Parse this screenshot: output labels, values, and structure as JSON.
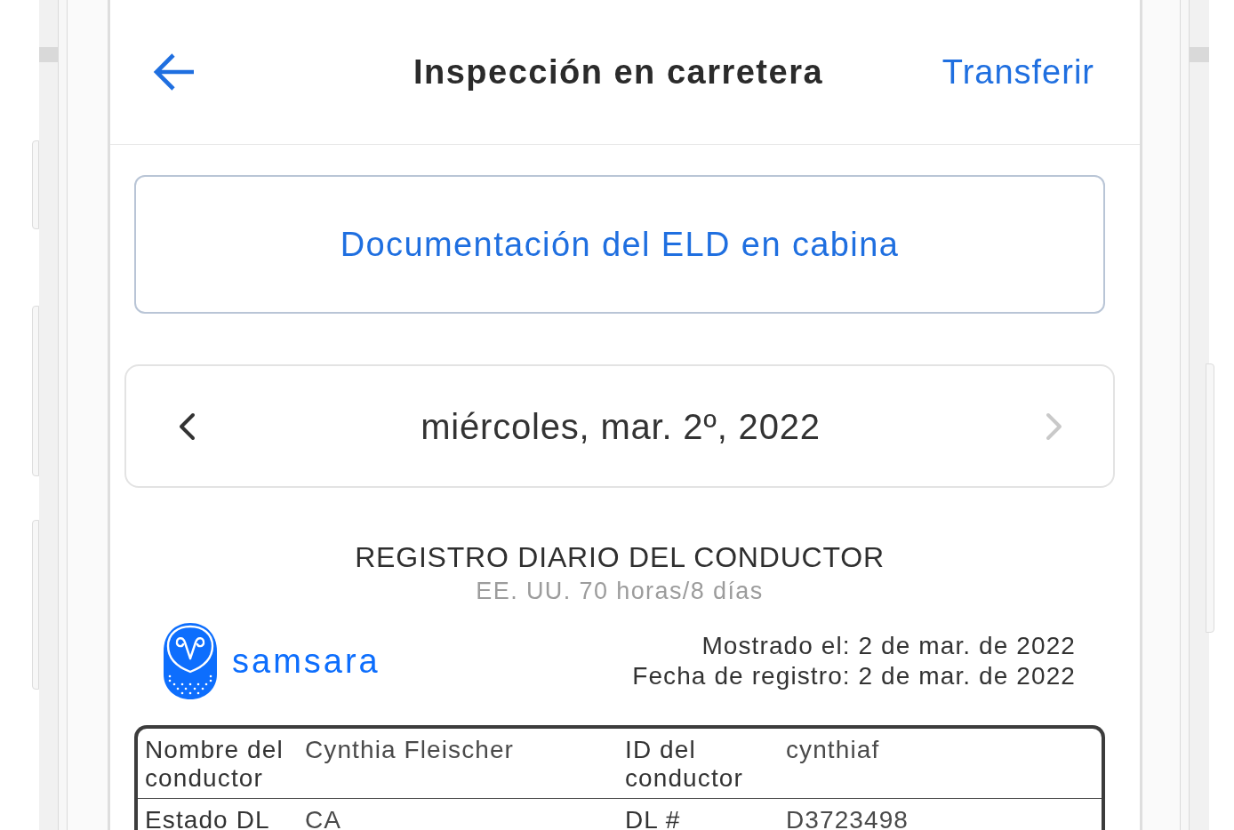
{
  "header": {
    "title": "Inspección en carretera",
    "action": "Transferir"
  },
  "primary_button": {
    "label": "Documentación del ELD en cabina"
  },
  "date_nav": {
    "prev": {
      "disabled": false
    },
    "date": "miércoles, mar. 2º, 2022",
    "next": {
      "disabled": true
    }
  },
  "log": {
    "title": "REGISTRO DIARIO DEL CONDUCTOR",
    "subtitle": "EE. UU. 70 horas/8 días",
    "logo": {
      "text": "samsara"
    },
    "meta": [
      "Mostrado el: 2 de mar. de 2022",
      "Fecha de registro: 2 de mar. de 2022"
    ],
    "driver_table": {
      "rows": [
        {
          "cells": [
            {
              "label": "Nombre del conductor",
              "value": "Cynthia Fleischer"
            },
            {
              "label": "ID del conductor",
              "value": "cynthiaf"
            }
          ]
        },
        {
          "cells": [
            {
              "label": "Estado DL",
              "value": "CA"
            },
            {
              "label": "DL #",
              "value": "D3723498"
            }
          ]
        }
      ]
    }
  }
}
